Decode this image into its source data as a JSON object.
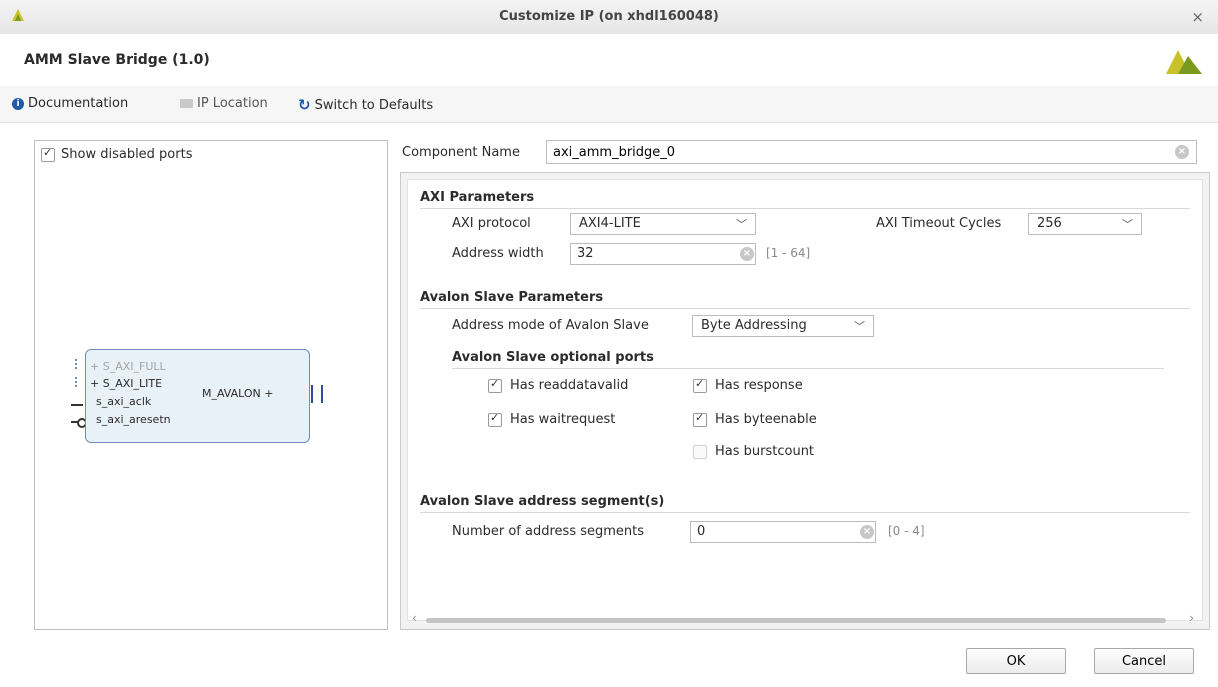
{
  "window": {
    "title": "Customize IP (on xhdl160048)",
    "close_glyph": "×"
  },
  "header": {
    "ip_name": "AMM Slave Bridge (1.0)"
  },
  "toolbar": {
    "documentation": "Documentation",
    "ip_location": "IP Location",
    "switch_defaults": "Switch to Defaults"
  },
  "left_panel": {
    "show_disabled_ports": "Show disabled ports",
    "show_disabled_checked": true,
    "block": {
      "ports_left": [
        "S_AXI_FULL",
        "S_AXI_LITE",
        "s_axi_aclk",
        "s_axi_aresetn"
      ],
      "port_right": "M_AVALON"
    }
  },
  "component": {
    "label": "Component Name",
    "value": "axi_amm_bridge_0"
  },
  "axi_params": {
    "title": "AXI Parameters",
    "protocol_label": "AXI protocol",
    "protocol_value": "AXI4-LITE",
    "timeout_label": "AXI Timeout Cycles",
    "timeout_value": "256",
    "addr_width_label": "Address width",
    "addr_width_value": "32",
    "addr_width_range": "[1 - 64]"
  },
  "avalon_params": {
    "title": "Avalon Slave Parameters",
    "addr_mode_label": "Address mode of Avalon Slave",
    "addr_mode_value": "Byte Addressing",
    "optional_title": "Avalon Slave optional ports",
    "options": {
      "readdatavalid": "Has readdatavalid",
      "response": "Has response",
      "waitrequest": "Has waitrequest",
      "byteenable": "Has byteenable",
      "burstcount": "Has burstcount"
    }
  },
  "segments": {
    "title": "Avalon Slave address segment(s)",
    "num_label": "Number of address segments",
    "num_value": "0",
    "num_range": "[0 - 4]"
  },
  "buttons": {
    "ok": "OK",
    "cancel": "Cancel"
  },
  "colors": {
    "accent_blue": "#1e5aa8",
    "logo_green": "#7a9a1e",
    "logo_yellow": "#c8c22a",
    "block_fill": "#e8f0f8"
  }
}
